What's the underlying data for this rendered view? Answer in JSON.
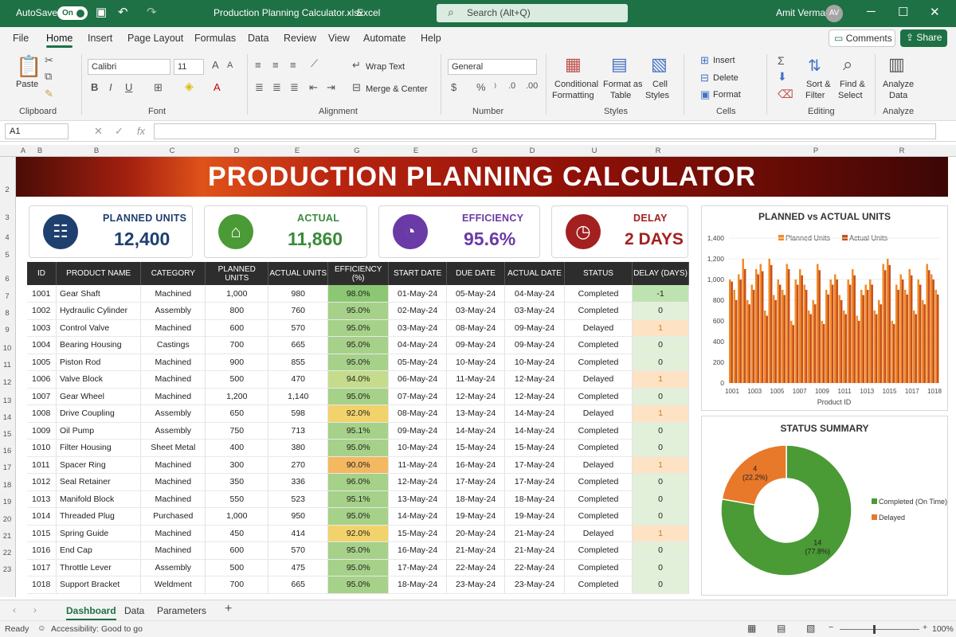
{
  "titlebar": {
    "autosave": "AutoSave",
    "autosave_state": "On",
    "filename": "Production Planning Calculator.xlsx",
    "app": "Excel",
    "search_placeholder": "Search (Alt+Q)",
    "user": "Amit Verma",
    "initials": "AV"
  },
  "menu": {
    "items": [
      "File",
      "Home",
      "Insert",
      "Page Layout",
      "Formulas",
      "Data",
      "Review",
      "View",
      "Automate",
      "Help"
    ],
    "active": "Home",
    "comments": "Comments",
    "share": "Share"
  },
  "ribbon": {
    "clipboard": {
      "label": "Clipboard",
      "paste": "Paste"
    },
    "font": {
      "label": "Font",
      "name": "Calibri",
      "size": "11"
    },
    "alignment": {
      "label": "Alignment",
      "wrap": "Wrap Text",
      "merge": "Merge & Center"
    },
    "number": {
      "label": "Number",
      "format": "General"
    },
    "styles": {
      "label": "Styles",
      "conditional": "Conditional",
      "formatting": "Formatting",
      "format_as": "Format as",
      "table": "Table",
      "cell": "Cell",
      "cell_styles": "Styles"
    },
    "cells": {
      "label": "Cells",
      "insert": "Insert",
      "delete": "Delete",
      "format": "Format"
    },
    "editing": {
      "label": "Editing",
      "sort": "Sort &",
      "filter": "Filter",
      "find": "Find &",
      "select": "Select"
    },
    "analyze": {
      "label": "Analyze",
      "analyze": "Analyze",
      "data": "Data"
    }
  },
  "formula": {
    "cell_ref": "A1",
    "fx": "fx"
  },
  "columns": [
    "A",
    "B",
    "B",
    "C",
    "D",
    "E",
    "G",
    "E",
    "G",
    "D",
    "U",
    "R",
    "P",
    "R"
  ],
  "rows": [
    "2",
    "3",
    "4",
    "5",
    "6",
    "7",
    "8",
    "9",
    "10",
    "11",
    "12",
    "13",
    "14",
    "15",
    "16",
    "17",
    "18",
    "19",
    "20",
    "21",
    "22",
    "23"
  ],
  "banner": "PRODUCTION PLANNING CALCULATOR",
  "kpis": [
    {
      "label": "PLANNED UNITS",
      "value": "12,400",
      "color": "#1f3f6e",
      "icon": "clipboard-icon"
    },
    {
      "label": "ACTUAL",
      "value": "11,860",
      "color": "#3a8a3a",
      "icon": "factory-icon"
    },
    {
      "label": "EFFICIENCY",
      "value": "95.6%",
      "color": "#6a3aa6",
      "icon": "gauge-icon"
    },
    {
      "label": "DELAY",
      "value": "2 DAYS",
      "color": "#a32020",
      "icon": "clock-icon"
    }
  ],
  "table": {
    "headers": [
      "ID",
      "PRODUCT NAME",
      "CATEGORY",
      "PLANNED UNITS",
      "ACTUAL UNITS",
      "EFFICIENCY (%)",
      "START DATE",
      "DUE DATE",
      "ACTUAL DATE",
      "STATUS",
      "DELAY (DAYS)"
    ],
    "rows": [
      [
        "1001",
        "Gear Shaft",
        "Machined",
        "1,000",
        "980",
        "98.0%",
        "01-May-24",
        "05-May-24",
        "04-May-24",
        "Completed",
        "-1"
      ],
      [
        "1002",
        "Hydraulic Cylinder",
        "Assembly",
        "800",
        "760",
        "95.0%",
        "02-May-24",
        "03-May-24",
        "03-May-24",
        "Completed",
        "0"
      ],
      [
        "1003",
        "Control Valve",
        "Machined",
        "600",
        "570",
        "95.0%",
        "03-May-24",
        "08-May-24",
        "09-May-24",
        "Delayed",
        "1"
      ],
      [
        "1004",
        "Bearing Housing",
        "Castings",
        "700",
        "665",
        "95.0%",
        "04-May-24",
        "09-May-24",
        "09-May-24",
        "Completed",
        "0"
      ],
      [
        "1005",
        "Piston Rod",
        "Machined",
        "900",
        "855",
        "95.0%",
        "05-May-24",
        "10-May-24",
        "10-May-24",
        "Completed",
        "0"
      ],
      [
        "1006",
        "Valve Block",
        "Machined",
        "500",
        "470",
        "94.0%",
        "06-May-24",
        "11-May-24",
        "12-May-24",
        "Delayed",
        "1"
      ],
      [
        "1007",
        "Gear Wheel",
        "Machined",
        "1,200",
        "1,140",
        "95.0%",
        "07-May-24",
        "12-May-24",
        "12-May-24",
        "Completed",
        "0"
      ],
      [
        "1008",
        "Drive Coupling",
        "Assembly",
        "650",
        "598",
        "92.0%",
        "08-May-24",
        "13-May-24",
        "14-May-24",
        "Delayed",
        "1"
      ],
      [
        "1009",
        "Oil Pump",
        "Assembly",
        "750",
        "713",
        "95.1%",
        "09-May-24",
        "14-May-24",
        "14-May-24",
        "Completed",
        "0"
      ],
      [
        "1010",
        "Filter Housing",
        "Sheet Metal",
        "400",
        "380",
        "95.0%",
        "10-May-24",
        "15-May-24",
        "15-May-24",
        "Completed",
        "0"
      ],
      [
        "1011",
        "Spacer Ring",
        "Machined",
        "300",
        "270",
        "90.0%",
        "11-May-24",
        "16-May-24",
        "17-May-24",
        "Delayed",
        "1"
      ],
      [
        "1012",
        "Seal Retainer",
        "Machined",
        "350",
        "336",
        "96.0%",
        "12-May-24",
        "17-May-24",
        "17-May-24",
        "Completed",
        "0"
      ],
      [
        "1013",
        "Manifold Block",
        "Machined",
        "550",
        "523",
        "95.1%",
        "13-May-24",
        "18-May-24",
        "18-May-24",
        "Completed",
        "0"
      ],
      [
        "1014",
        "Threaded Plug",
        "Purchased",
        "1,000",
        "950",
        "95.0%",
        "14-May-24",
        "19-May-24",
        "19-May-24",
        "Completed",
        "0"
      ],
      [
        "1015",
        "Spring Guide",
        "Machined",
        "450",
        "414",
        "92.0%",
        "15-May-24",
        "20-May-24",
        "21-May-24",
        "Delayed",
        "1"
      ],
      [
        "1016",
        "End Cap",
        "Machined",
        "600",
        "570",
        "95.0%",
        "16-May-24",
        "21-May-24",
        "21-May-24",
        "Completed",
        "0"
      ],
      [
        "1017",
        "Throttle Lever",
        "Assembly",
        "500",
        "475",
        "95.0%",
        "17-May-24",
        "22-May-24",
        "22-May-24",
        "Completed",
        "0"
      ],
      [
        "1018",
        "Support Bracket",
        "Weldment",
        "700",
        "665",
        "95.0%",
        "18-May-24",
        "23-May-24",
        "23-May-24",
        "Completed",
        "0"
      ]
    ]
  },
  "chart_data": [
    {
      "type": "bar",
      "title": "PLANNED vs ACTUAL UNITS",
      "xlabel": "Product ID",
      "ylabel": "",
      "ylim": [
        0,
        1400
      ],
      "yticks": [
        "0",
        "200",
        "400",
        "600",
        "800",
        "1,000",
        "1,200",
        "1,400"
      ],
      "x_tick_labels": [
        "1001",
        "1003",
        "1005",
        "1007",
        "1009",
        "1011",
        "1013",
        "1015",
        "1017",
        "1018"
      ],
      "legend": "top",
      "colors": [
        "#f08a28",
        "#c8501b"
      ],
      "series": [
        {
          "name": "Planned Units",
          "values": [
            1000,
            900,
            1050,
            1200,
            800,
            950,
            1100,
            1150,
            700,
            1200,
            850,
            1000,
            900,
            1150,
            600,
            1000,
            1100,
            950,
            700,
            800,
            1150,
            600,
            900,
            1000,
            1050,
            850,
            700,
            1000,
            1100,
            650,
            900,
            950,
            1000,
            700,
            800,
            1150,
            1200,
            600,
            950,
            1050,
            900,
            1100,
            700,
            1000,
            800,
            1150,
            1050,
            900
          ]
        },
        {
          "name": "Actual Units",
          "values": [
            980,
            800,
            1000,
            1100,
            760,
            900,
            1050,
            1080,
            650,
            1140,
            800,
            950,
            850,
            1100,
            560,
            950,
            1040,
            900,
            665,
            760,
            1090,
            570,
            855,
            950,
            1000,
            800,
            665,
            950,
            1040,
            600,
            850,
            900,
            950,
            665,
            760,
            1090,
            1140,
            570,
            900,
            1000,
            855,
            1040,
            665,
            950,
            760,
            1090,
            1000,
            855
          ]
        }
      ]
    },
    {
      "type": "pie",
      "title": "STATUS SUMMARY",
      "categories": [
        "Completed (On Time)",
        "Delayed"
      ],
      "values": [
        14,
        4
      ],
      "labels": [
        "14\n(77.8%)",
        "4\n(22.2%)"
      ],
      "legend": "right",
      "colors": [
        "#4a9a35",
        "#e8782a"
      ]
    }
  ],
  "sheets": [
    "Dashboard",
    "Data",
    "Parameters"
  ],
  "active_sheet": "Dashboard",
  "status": {
    "ready": "Ready",
    "accessibility": "Accessibility: Good to go",
    "zoom": "100%"
  }
}
